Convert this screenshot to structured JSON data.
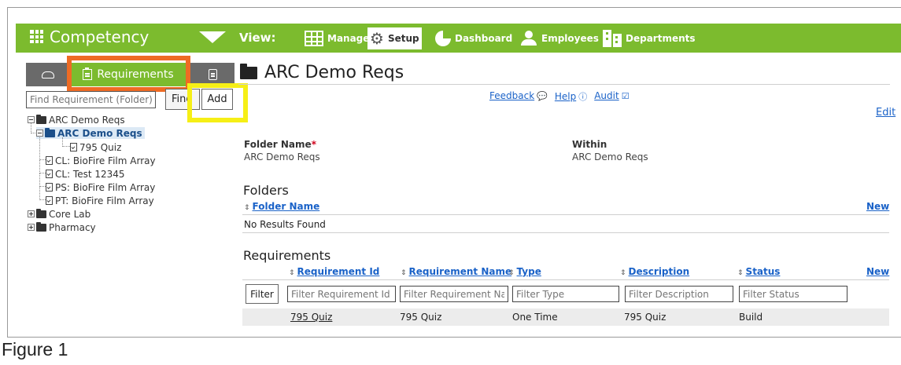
{
  "app": {
    "title": "Competency"
  },
  "nav": {
    "view_label": "View:",
    "items": [
      {
        "label": "Manage",
        "icon": "grid-icon"
      },
      {
        "label": "Setup",
        "icon": "gear-icon"
      },
      {
        "label": "Dashboard",
        "icon": "pie-chart-icon"
      },
      {
        "label": "Employees",
        "icon": "person-icon"
      },
      {
        "label": "Departments",
        "icon": "building-icon"
      }
    ]
  },
  "sidebar": {
    "tabs": {
      "requirements": "Requirements"
    },
    "find_placeholder": "Find Requirement (Folder)",
    "find_button": "Find",
    "add_button": "Add",
    "tree": [
      {
        "label": "ARC Demo Reqs"
      },
      {
        "label": "ARC Demo Reqs"
      },
      {
        "label": "795 Quiz"
      },
      {
        "label": "CL: BioFire Film Array"
      },
      {
        "label": "CL: Test 12345"
      },
      {
        "label": "PS: BioFire Film Array"
      },
      {
        "label": "PT: BioFire Film Array"
      },
      {
        "label": "Core Lab"
      },
      {
        "label": "Pharmacy"
      }
    ]
  },
  "main": {
    "title": "ARC Demo Reqs",
    "links": {
      "feedback": "Feedback",
      "help": "Help",
      "audit": "Audit"
    },
    "edit": "Edit",
    "folder_name_label": "Folder Name",
    "folder_name_value": "ARC Demo Reqs",
    "within_label": "Within",
    "within_value": "ARC Demo Reqs",
    "folders": {
      "title": "Folders",
      "column": "Folder Name",
      "new": "New",
      "empty": "No Results Found"
    },
    "requirements": {
      "title": "Requirements",
      "columns": [
        "Requirement Id",
        "Requirement Name",
        "Type",
        "Description",
        "Status"
      ],
      "new": "New",
      "filter_button": "Filter",
      "filter_placeholders": [
        "Filter Requirement Id",
        "Filter Requirement Name",
        "Filter Type",
        "Filter Description",
        "Filter Status"
      ],
      "rows": [
        {
          "id": "795 Quiz",
          "name": "795 Quiz",
          "type": "One Time",
          "description": "795 Quiz",
          "status": "Build"
        }
      ]
    }
  },
  "caption": "Figure 1",
  "colors": {
    "brand_green": "#7cbb2e",
    "highlight_orange": "#ee6b24",
    "highlight_yellow": "#f6ef16",
    "link_blue": "#1a62c8"
  }
}
